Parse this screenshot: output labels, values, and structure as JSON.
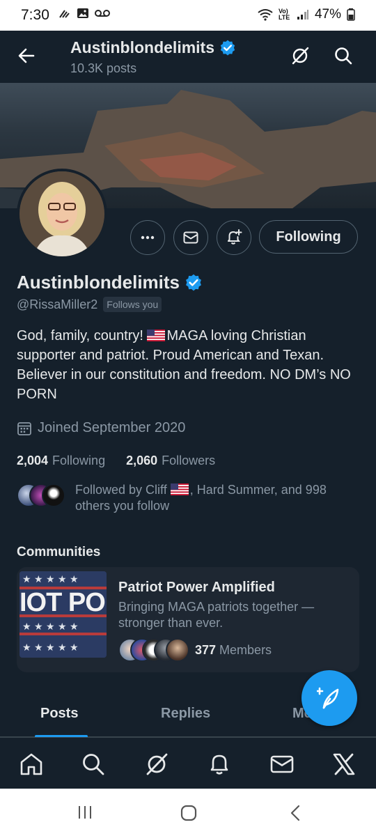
{
  "status": {
    "time": "7:30",
    "battery": "47%",
    "lte": "Vo) LTE"
  },
  "header": {
    "title": "Austinblondelimits",
    "posts": "10.3K posts"
  },
  "profile": {
    "display_name": "Austinblondelimits",
    "handle": "@RissaMiller2",
    "follows_you": "Follows you",
    "bio_line1_prefix": "God, family, country! ",
    "bio_line1_suffix": "MAGA loving Christian",
    "bio_rest": "supporter and patriot. Proud American and Texan. Believer in our constitution and freedom. NO DM’s NO PORN",
    "joined": "Joined September 2020",
    "following_count": "2,004",
    "following_label": "Following",
    "followers_count": "2,060",
    "followers_label": "Followers",
    "followed_by_prefix": "Followed by Cliff ",
    "followed_by_suffix": ", Hard Summer, and 998 others you follow"
  },
  "actions": {
    "follow_label": "Following"
  },
  "communities": {
    "heading": "Communities",
    "card": {
      "image_text": "IOT PO",
      "title": "Patriot Power Amplified",
      "description": "Bringing MAGA patriots together — stronger than ever.",
      "members_count": "377",
      "members_label": "Members"
    }
  },
  "tabs": [
    "Posts",
    "Replies",
    "Media"
  ],
  "icons": {
    "back": "arrow-left-icon",
    "grok": "grok-icon",
    "search": "search-icon",
    "more": "more-icon",
    "message": "envelope-icon",
    "notify": "bell-plus-icon",
    "calendar": "calendar-icon",
    "compose": "compose-icon",
    "nav": [
      "home-icon",
      "search-icon",
      "grok-icon",
      "bell-icon",
      "envelope-icon",
      "x-logo-icon"
    ]
  },
  "colors": {
    "background": "#15202b",
    "accent": "#1d9bf0",
    "muted": "#8b98a5",
    "text": "#e7e9ea",
    "verified": "#1d9bf0"
  }
}
